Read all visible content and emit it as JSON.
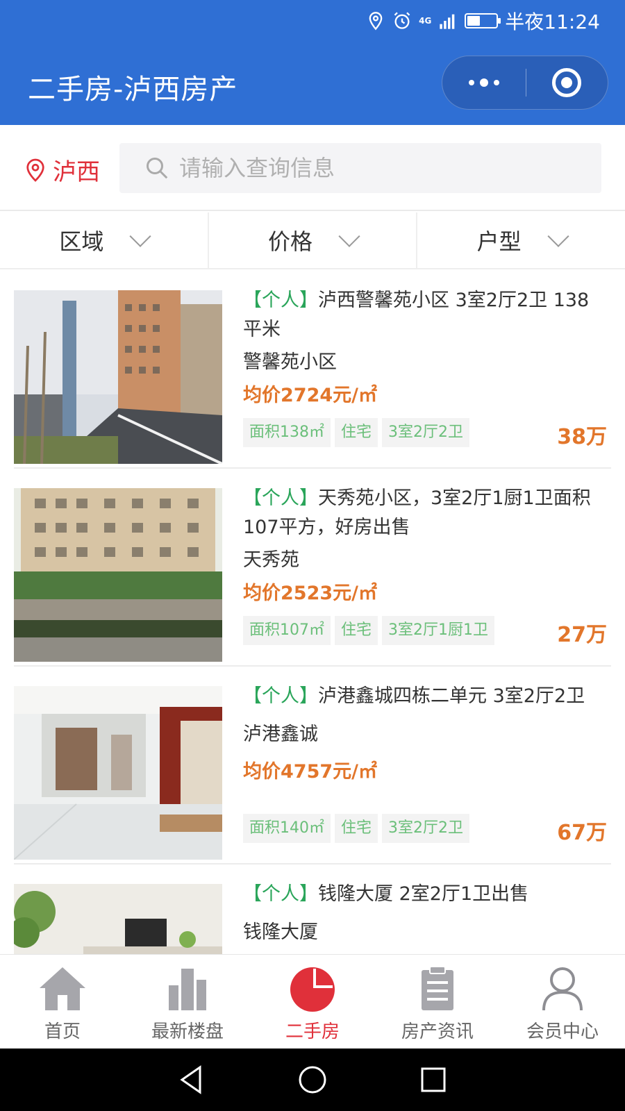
{
  "status_bar": {
    "time": "半夜11:24",
    "network": "4G",
    "battery_percent": 45
  },
  "header": {
    "title": "二手房-泸西房产"
  },
  "search": {
    "city": "泸西",
    "placeholder": "请输入查询信息"
  },
  "filters": [
    {
      "label": "区域"
    },
    {
      "label": "价格"
    },
    {
      "label": "户型"
    }
  ],
  "listings": [
    {
      "tag": "【个人】",
      "title": "泸西警馨苑小区 3室2厅2卫 138平米",
      "estate": "警馨苑小区",
      "unit_price": "均价2724元/㎡",
      "chips": [
        "面积138㎡",
        "住宅",
        "3室2厅2卫"
      ],
      "total_price": "38万"
    },
    {
      "tag": "【个人】",
      "title": "天秀苑小区，3室2厅1厨1卫面积107平方，好房出售",
      "estate": "天秀苑",
      "unit_price": "均价2523元/㎡",
      "chips": [
        "面积107㎡",
        "住宅",
        "3室2厅1厨1卫"
      ],
      "total_price": "27万"
    },
    {
      "tag": "【个人】",
      "title": "泸港鑫城四栋二单元 3室2厅2卫",
      "estate": "泸港鑫诚",
      "unit_price": "均价4757元/㎡",
      "chips": [
        "面积140㎡",
        "住宅",
        "3室2厅2卫"
      ],
      "total_price": "67万"
    },
    {
      "tag": "【个人】",
      "title": "钱隆大厦 2室2厅1卫出售",
      "estate": "钱隆大厦",
      "unit_price": "",
      "chips": [],
      "total_price": ""
    }
  ],
  "tabbar": [
    {
      "label": "首页",
      "icon": "home-icon"
    },
    {
      "label": "最新楼盘",
      "icon": "buildings-icon"
    },
    {
      "label": "二手房",
      "icon": "pie-icon",
      "active": true
    },
    {
      "label": "房产资讯",
      "icon": "clipboard-icon"
    },
    {
      "label": "会员中心",
      "icon": "user-icon"
    }
  ],
  "colors": {
    "header_bg": "#2f6fd4",
    "accent_red": "#e0303a",
    "price_orange": "#e2762b",
    "tag_green": "#2aa55a"
  }
}
